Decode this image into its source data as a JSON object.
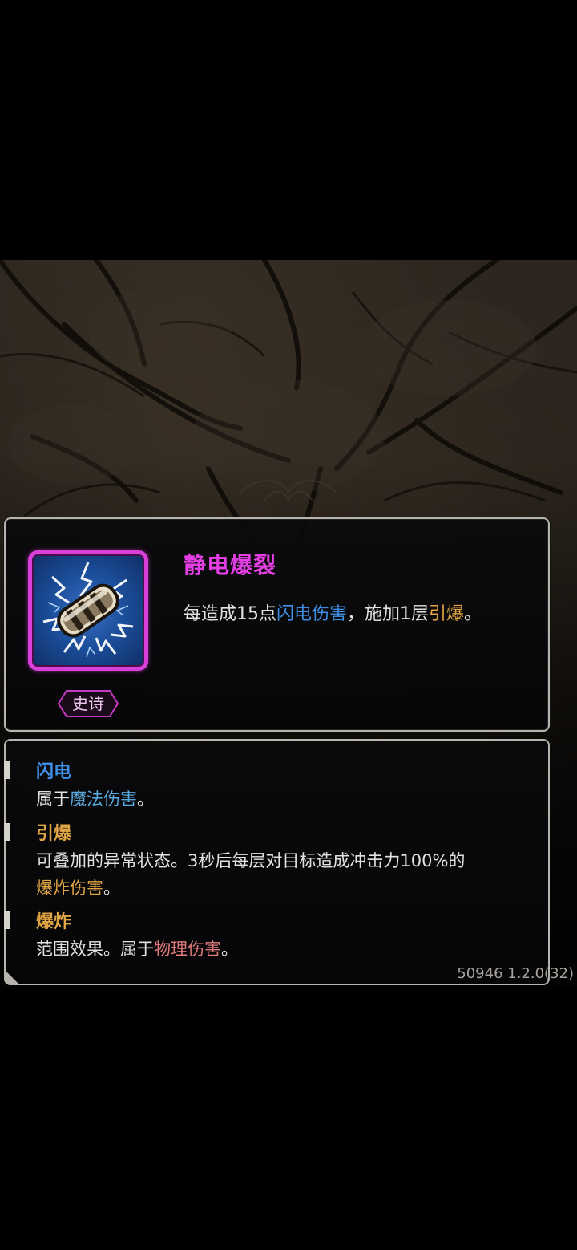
{
  "skill": {
    "title": "静电爆裂",
    "rarity": "史诗",
    "icon": "lightning-stone-icon",
    "description": {
      "p1": "每造成15点",
      "kw1": "闪电伤害",
      "p2": "，施加1层",
      "kw2": "引爆",
      "p3": "。"
    }
  },
  "keywords": [
    {
      "name": "闪电",
      "body": {
        "p1": "属于",
        "kw": "魔法伤害",
        "p2": "。"
      }
    },
    {
      "name": "引爆",
      "body": {
        "line1": "可叠加的异常状态。3秒后每层对目标造成冲击力100%的",
        "kw": "爆炸伤害",
        "p2": "。"
      }
    },
    {
      "name": "爆炸",
      "body": {
        "p1": "范围效果。属于",
        "kw": "物理伤害",
        "p2": "。"
      }
    }
  ],
  "version": "50946 1.2.0(32)",
  "colors": {
    "epic": "#e43fe4",
    "lightning": "#3f8fe6",
    "detonate": "#e0a544",
    "magic": "#5aa9dd",
    "physical": "#e07c7c",
    "frame": "#b7b4ae"
  }
}
